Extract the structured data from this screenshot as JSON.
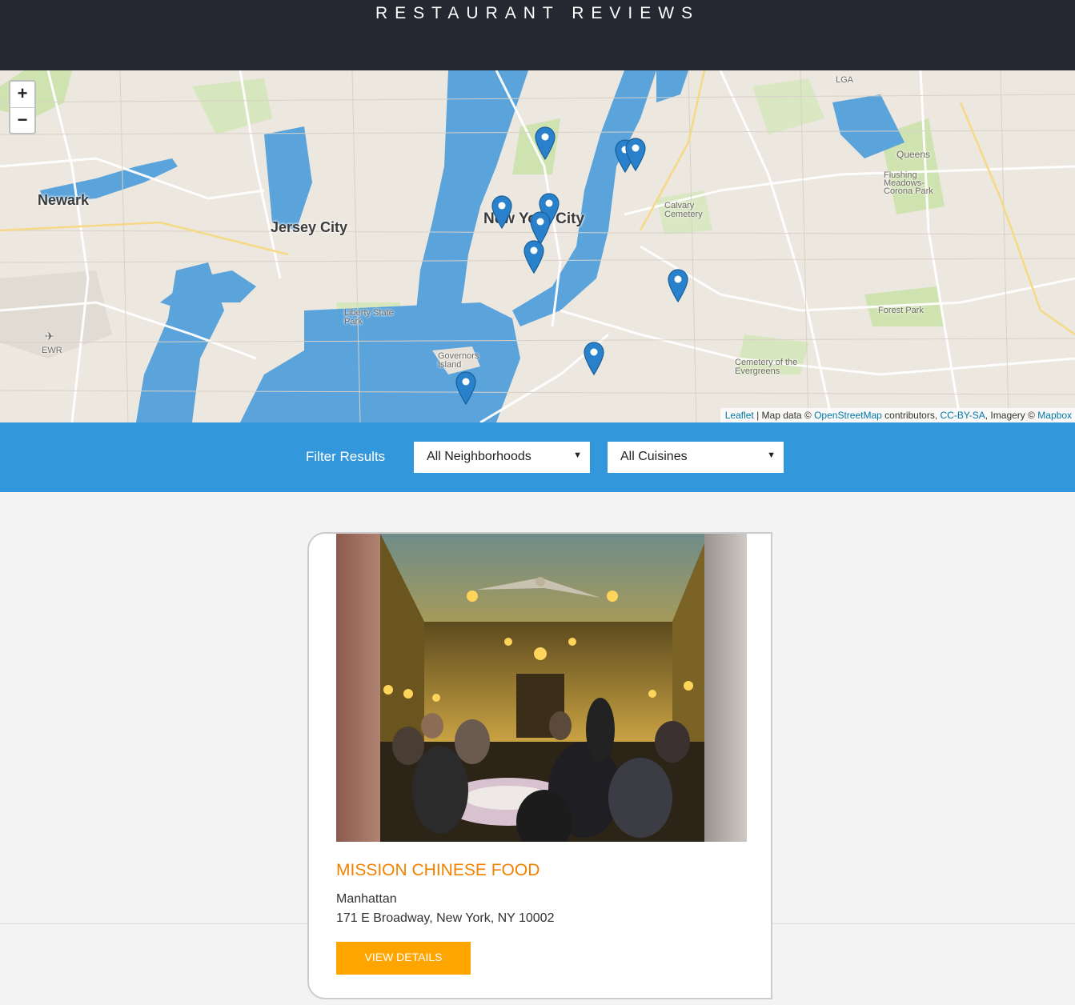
{
  "header": {
    "title": "RESTAURANT REVIEWS"
  },
  "map": {
    "zoom_in": "+",
    "zoom_out": "−",
    "labels": {
      "newark": "Newark",
      "jersey_city": "Jersey City",
      "nyc": "New York City",
      "queens": "Queens",
      "flushing": "Flushing Meadows-Corona Park",
      "liberty": "Liberty State Park",
      "governors": "Governors Island",
      "calvary": "Calvary Cemetery",
      "forest_park": "Forest Park",
      "evergreens": "Cemetery of the Evergreens",
      "lga": "LGA",
      "ewr": "EWR"
    },
    "attribution": {
      "leaflet": "Leaflet",
      "sep": " | Map data © ",
      "osm": "OpenStreetMap",
      "contrib": " contributors, ",
      "license": "CC-BY-SA",
      "imagery": ", Imagery © ",
      "mapbox": "Mapbox"
    },
    "marker_color": "#2a81cb"
  },
  "filter": {
    "label": "Filter Results",
    "neighborhoods": "All Neighborhoods",
    "cuisines": "All Cuisines"
  },
  "restaurants": [
    {
      "name": "MISSION CHINESE FOOD",
      "neighborhood": "Manhattan",
      "address": "171 E Broadway, New York, NY 10002",
      "button": "VIEW DETAILS"
    }
  ],
  "colors": {
    "header_bg": "#252831",
    "filter_bg": "#3397db",
    "accent_orange": "#f18200",
    "button_bg": "#fea500"
  }
}
